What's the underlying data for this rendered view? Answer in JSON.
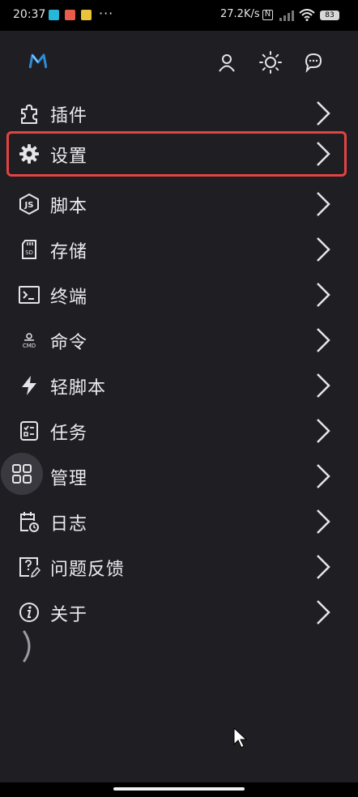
{
  "status_bar": {
    "time": "20:37",
    "net_speed": "27.2K/s",
    "battery": "83",
    "dots": "···"
  },
  "header": {
    "logo_icon": "m-logo",
    "actions": [
      "user-icon",
      "brightness-icon",
      "chat-icon"
    ]
  },
  "menu": {
    "items": [
      {
        "label": "插件",
        "icon": "puzzle-icon"
      },
      {
        "label": "设置",
        "icon": "gear-icon"
      },
      {
        "label": "脚本",
        "icon": "nodejs-icon"
      },
      {
        "label": "存储",
        "icon": "sd-card-icon"
      },
      {
        "label": "终端",
        "icon": "terminal-icon"
      },
      {
        "label": "命令",
        "icon": "cmd-icon"
      },
      {
        "label": "轻脚本",
        "icon": "lightning-icon"
      },
      {
        "label": "任务",
        "icon": "task-list-icon"
      },
      {
        "label": "管理",
        "icon": "grid-icon"
      },
      {
        "label": "日志",
        "icon": "log-calendar-icon"
      },
      {
        "label": "问题反馈",
        "icon": "feedback-icon"
      },
      {
        "label": "关于",
        "icon": "info-icon"
      }
    ],
    "selected": "设置"
  },
  "colors": {
    "background": "#1f1e23",
    "selection_border": "#e24343",
    "logo_accent": "#2f8cd8"
  },
  "cmd_icon_text": "CMD",
  "sd_icon_text": "SD",
  "js_icon_text": "JS"
}
